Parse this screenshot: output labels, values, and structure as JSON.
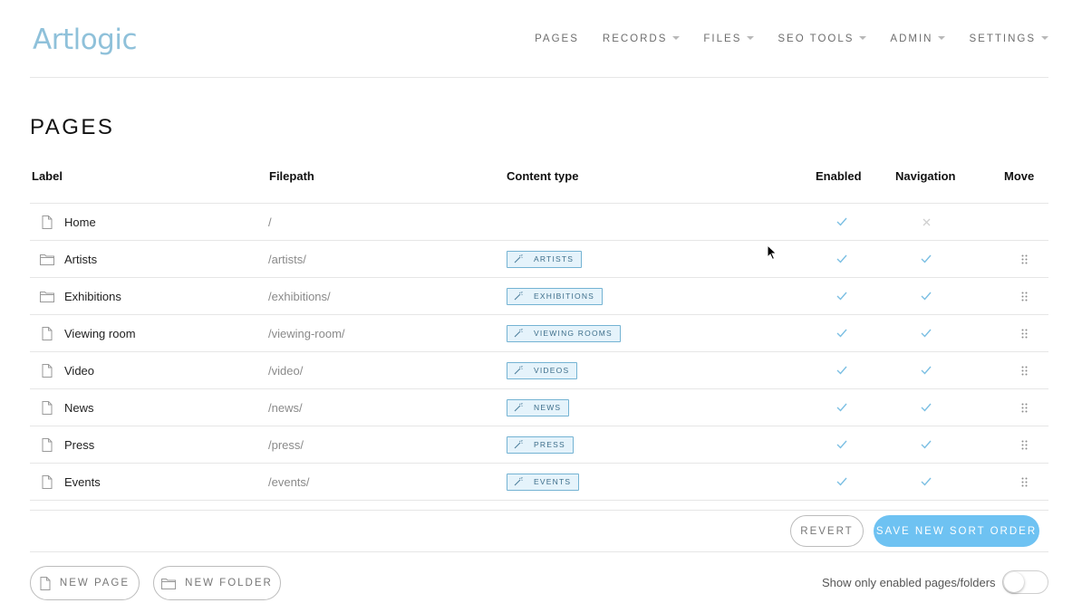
{
  "header": {
    "logo": "Artlogic",
    "nav": [
      {
        "label": "PAGES",
        "dropdown": false
      },
      {
        "label": "RECORDS",
        "dropdown": true
      },
      {
        "label": "FILES",
        "dropdown": true
      },
      {
        "label": "SEO TOOLS",
        "dropdown": true
      },
      {
        "label": "ADMIN",
        "dropdown": true
      },
      {
        "label": "SETTINGS",
        "dropdown": true
      }
    ]
  },
  "page_title": "PAGES",
  "table": {
    "columns": {
      "label": "Label",
      "filepath": "Filepath",
      "content_type": "Content type",
      "enabled": "Enabled",
      "navigation": "Navigation",
      "move": "Move"
    },
    "rows": [
      {
        "icon": "file-icon",
        "label": "Home",
        "filepath": "/",
        "content_type": "",
        "enabled": true,
        "navigation": false,
        "movable": false
      },
      {
        "icon": "folder-icon",
        "label": "Artists",
        "filepath": "/artists/",
        "content_type": "ARTISTS",
        "enabled": true,
        "navigation": true,
        "movable": true
      },
      {
        "icon": "folder-icon",
        "label": "Exhibitions",
        "filepath": "/exhibitions/",
        "content_type": "EXHIBITIONS",
        "enabled": true,
        "navigation": true,
        "movable": true
      },
      {
        "icon": "file-icon",
        "label": "Viewing room",
        "filepath": "/viewing-room/",
        "content_type": "VIEWING ROOMS",
        "enabled": true,
        "navigation": true,
        "movable": true
      },
      {
        "icon": "file-icon",
        "label": "Video",
        "filepath": "/video/",
        "content_type": "VIDEOS",
        "enabled": true,
        "navigation": true,
        "movable": true
      },
      {
        "icon": "file-icon",
        "label": "News",
        "filepath": "/news/",
        "content_type": "NEWS",
        "enabled": true,
        "navigation": true,
        "movable": true
      },
      {
        "icon": "file-icon",
        "label": "Press",
        "filepath": "/press/",
        "content_type": "PRESS",
        "enabled": true,
        "navigation": true,
        "movable": true
      },
      {
        "icon": "file-icon",
        "label": "Events",
        "filepath": "/events/",
        "content_type": "EVENTS",
        "enabled": true,
        "navigation": true,
        "movable": true
      }
    ]
  },
  "actions": {
    "revert": "REVERT",
    "save": "SAVE NEW SORT ORDER"
  },
  "footer": {
    "new_page": "NEW PAGE",
    "new_folder": "NEW FOLDER",
    "toggle_label": "Show only enabled pages/folders",
    "toggle_on": false
  },
  "colors": {
    "accent": "#6ec2f2",
    "logo": "#8fc1da",
    "check": "#7bbfe3",
    "badge_border": "#74b3d3",
    "badge_bg": "#e5f3fb"
  }
}
